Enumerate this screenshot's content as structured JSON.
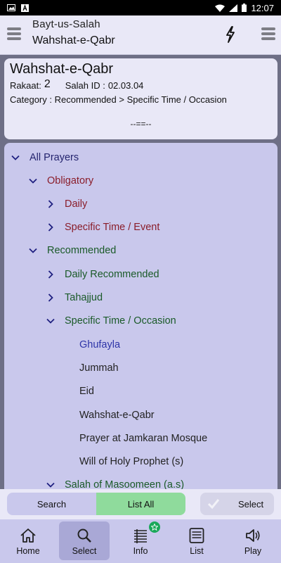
{
  "status_bar": {
    "time": "12:07"
  },
  "app_bar": {
    "title": "Bayt-us-Salah",
    "subtitle": "Wahshat-e-Qabr"
  },
  "card": {
    "title": "Wahshat-e-Qabr",
    "rakaat_label": "Rakaat:",
    "rakaat_value": "2",
    "salah_id_label": "Salah ID :",
    "salah_id_value": "02.03.04",
    "category_label": "Category :",
    "category_value": "Recommended > Specific Time / Occasion",
    "divider": "--==--"
  },
  "tree": {
    "all_prayers": "All Prayers",
    "obligatory": "Obligatory",
    "daily": "Daily",
    "specific_event": "Specific Time / Event",
    "recommended": "Recommended",
    "daily_recommended": "Daily Recommended",
    "tahajjud": "Tahajjud",
    "specific_occasion": "Specific Time / Occasion",
    "ghufayla": "Ghufayla",
    "jummah": "Jummah",
    "eid": "Eid",
    "wahshat": "Wahshat-e-Qabr",
    "jamkaran": "Prayer at  Jamkaran Mosque",
    "will": "Will of Holy Prophet (s)",
    "masoomeen": "Salah of Masoomeen (a.s)"
  },
  "actions": {
    "search": "Search",
    "list_all": "List All",
    "select": "Select"
  },
  "bottom_nav": {
    "home": "Home",
    "select": "Select",
    "info": "Info",
    "list": "List",
    "play": "Play"
  }
}
